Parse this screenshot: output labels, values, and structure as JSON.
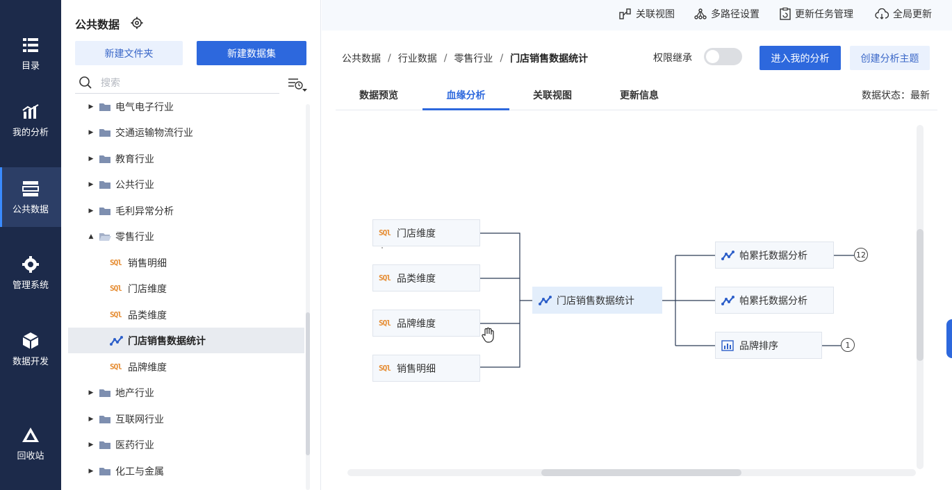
{
  "nav": {
    "items": [
      {
        "label": "目录",
        "icon": "catalog-icon"
      },
      {
        "label": "我的分析",
        "icon": "chart-icon"
      },
      {
        "label": "公共数据",
        "icon": "database-icon",
        "active": true
      },
      {
        "label": "管理系统",
        "icon": "gear-icon"
      },
      {
        "label": "数据开发",
        "icon": "cube-icon"
      },
      {
        "label": "回收站",
        "icon": "recycle-icon"
      }
    ]
  },
  "tree": {
    "title": "公共数据",
    "new_folder": "新建文件夹",
    "new_dataset": "新建数据集",
    "search_placeholder": "搜索",
    "nodes": [
      {
        "label": "电气电子行业",
        "type": "folder"
      },
      {
        "label": "交通运输物流行业",
        "type": "folder"
      },
      {
        "label": "教育行业",
        "type": "folder"
      },
      {
        "label": "公共行业",
        "type": "folder"
      },
      {
        "label": "毛利异常分析",
        "type": "folder"
      },
      {
        "label": "零售行业",
        "type": "folder-open"
      },
      {
        "label": "销售明细",
        "type": "sql"
      },
      {
        "label": "门店维度",
        "type": "sql"
      },
      {
        "label": "品类维度",
        "type": "sql"
      },
      {
        "label": "门店销售数据统计",
        "type": "analysis",
        "selected": true
      },
      {
        "label": "品牌维度",
        "type": "sql"
      },
      {
        "label": "地产行业",
        "type": "folder"
      },
      {
        "label": "互联网行业",
        "type": "folder"
      },
      {
        "label": "医药行业",
        "type": "folder"
      },
      {
        "label": "化工与金属",
        "type": "folder"
      }
    ]
  },
  "toolbar": {
    "related_view": "关联视图",
    "multi_path": "多路径设置",
    "update_tasks": "更新任务管理",
    "global_update": "全局更新"
  },
  "breadcrumb": {
    "items": [
      "公共数据",
      "行业数据",
      "零售行业",
      "门店销售数据统计"
    ],
    "separator": "/"
  },
  "header": {
    "perm_label": "权限继承",
    "perm_on": false,
    "enter_analysis": "进入我的分析",
    "create_topic": "创建分析主题"
  },
  "tabs": {
    "items": [
      "数据预览",
      "血缘分析",
      "关联视图",
      "更新信息"
    ],
    "active": 1,
    "status": "数据状态：最新"
  },
  "lineage": {
    "sources": [
      "门店维度",
      "品类维度",
      "品牌维度",
      "销售明细"
    ],
    "center": "门店销售数据统计",
    "targets": [
      {
        "label": "帕累托数据分析",
        "type": "analysis",
        "count": "12"
      },
      {
        "label": "帕累托数据分析",
        "type": "analysis",
        "count": ""
      },
      {
        "label": "品牌排序",
        "type": "report",
        "count": "1"
      }
    ]
  },
  "colors": {
    "nav_bg": "#1c2a4a",
    "primary": "#2d68dd",
    "sql_orange": "#e58a2e"
  }
}
